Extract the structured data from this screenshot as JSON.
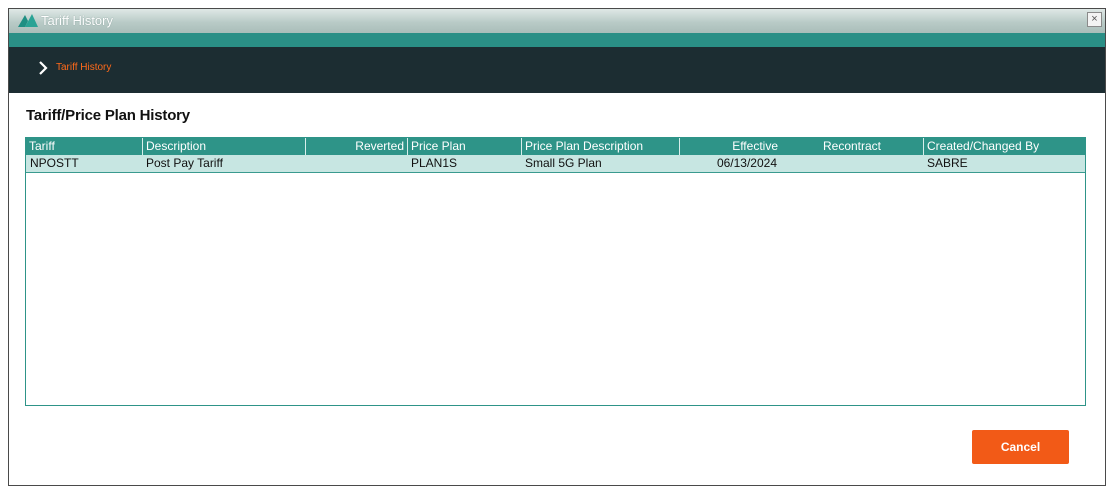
{
  "window": {
    "title": "Tariff History",
    "close_glyph": "×",
    "logo_icon": "app-logo-icon"
  },
  "breadcrumb": {
    "icon": "chevron-right-icon",
    "label": "Tariff History"
  },
  "page": {
    "title": "Tariff/Price Plan History"
  },
  "table": {
    "columns": [
      "Tariff",
      "Description",
      "Reverted",
      "Price Plan",
      "Price Plan Description",
      "Effective",
      "Recontract",
      "Created/Changed By"
    ],
    "rows": [
      {
        "tariff": "NPOSTT",
        "description": "Post Pay Tariff",
        "reverted": "",
        "price_plan": "PLAN1S",
        "price_plan_description": "Small 5G Plan",
        "effective": "06/13/2024",
        "recontract": "",
        "created_by": "SABRE"
      }
    ]
  },
  "buttons": {
    "cancel": "Cancel"
  },
  "colors": {
    "accent_teal": "#2e9488",
    "header_dark": "#1c2d32",
    "cancel_orange": "#f25a17",
    "breadcrumb_orange": "#ff6a1a",
    "row_selected": "#c7e6e2"
  }
}
